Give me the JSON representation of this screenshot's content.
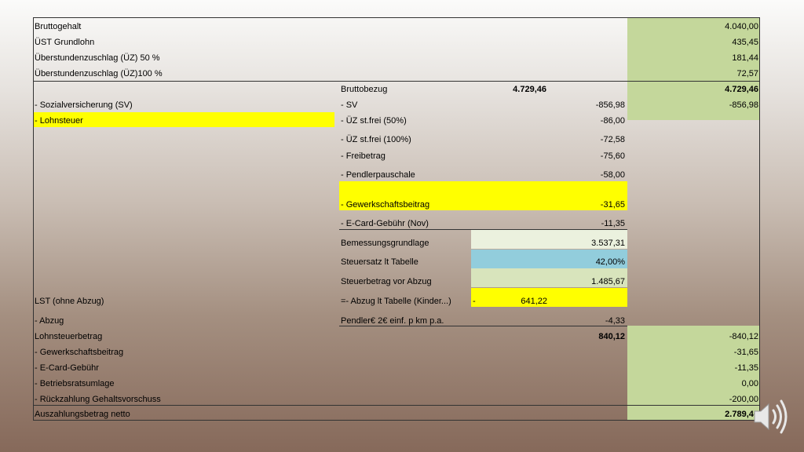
{
  "rows": {
    "bruttogehalt": {
      "label": "Bruttogehalt",
      "value": "4.040,00"
    },
    "ust_grundlohn": {
      "label": "ÜST Grundlohn",
      "value": "435,45"
    },
    "uez50": {
      "label": "Überstundenzuschlag (ÜZ) 50 %",
      "value": "181,44"
    },
    "uez100": {
      "label": "Überstundenzuschlag (ÜZ)100 %",
      "value": "72,57"
    },
    "bruttobezug": {
      "mid_label": "Bruttobezug",
      "mid_value": "4.729,46",
      "value": "4.729,46"
    },
    "sv": {
      "label": "- Sozialversicherung (SV)",
      "mid_label": "- SV",
      "mid_value": "-856,98",
      "value": "-856,98"
    },
    "lohnsteuer": {
      "label": "- Lohnsteuer",
      "mid_label": "- ÜZ st.frei (50%)",
      "mid_value": "-86,00"
    },
    "uez_frei100": {
      "mid_label": "- ÜZ st.frei (100%)",
      "mid_value": "-72,58"
    },
    "freibetrag": {
      "mid_label": "- Freibetrag",
      "mid_value": "-75,60"
    },
    "pendler": {
      "mid_label": "- Pendlerpauschale",
      "mid_value": "-58,00"
    },
    "gewerkschaft_mid": {
      "mid_label": "- Gewerkschaftsbeitrag",
      "mid_value": "-31,65"
    },
    "ecard_mid": {
      "mid_label": "- E-Card-Gebühr (Nov)",
      "mid_value": "-11,35"
    },
    "bemessung": {
      "mid_label": "Bemessungsgrundlage",
      "mid_value": "3.537,31"
    },
    "steuersatz": {
      "mid_label": "Steuersatz lt Tabelle",
      "mid_value": "42,00%"
    },
    "steuerbetrag": {
      "mid_label": "Steuerbetrag vor Abzug",
      "mid_value": "1.485,67"
    },
    "lst": {
      "label": "LST (ohne Abzug)",
      "mid_label": "=- Abzug lt Tabelle (Kinder...)",
      "dash": "-",
      "mid_value": "641,22"
    },
    "abzug": {
      "label": "- Abzug",
      "mid_label": "Pendler€ 2€ einf. p km p.a.",
      "mid_value": "-4,33"
    },
    "lohnsteuerbetrag": {
      "label": "Lohnsteuerbetrag",
      "mid_value": "840,12",
      "value": "-840,12"
    },
    "gewerkschaft": {
      "label": "- Gewerkschaftsbeitrag",
      "value": "-31,65"
    },
    "ecard": {
      "label": "- E-Card-Gebühr",
      "value": "-11,35"
    },
    "betriebsrat": {
      "label": "- Betriebsratsumlage",
      "value": "0,00"
    },
    "rueckzahlung": {
      "label": "- Rückzahlung Gehaltsvorschuss",
      "value": "-200,00"
    },
    "netto": {
      "label": "Auszahlungsbetrag netto",
      "value": "2.789,46"
    }
  },
  "colors": {
    "green": "#c4d79b",
    "yellow": "#ffff00",
    "light_green": "#ebf1de",
    "blue": "#92cddc",
    "sage": "#d8e4bc"
  },
  "icons": {
    "speaker": "speaker-icon"
  }
}
